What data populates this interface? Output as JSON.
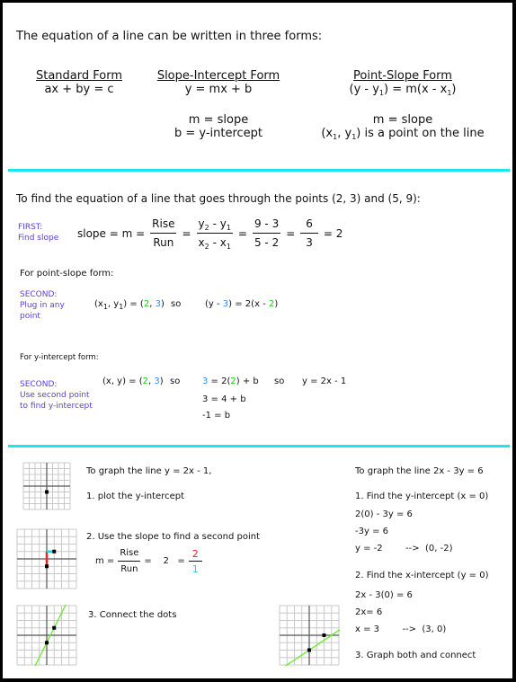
{
  "intro": "The equation of a line can be written in three forms:",
  "forms": [
    {
      "title": "Standard Form",
      "equation": "ax + by = c"
    },
    {
      "title": "Slope-Intercept Form",
      "equation": "y = mx + b",
      "notes": [
        "m = slope",
        "b = y-intercept"
      ]
    },
    {
      "title": "Point-Slope Form",
      "equation_parts": [
        "(y - y",
        "1",
        ") = m(x - x",
        "1",
        ")"
      ],
      "notes": [
        "m = slope"
      ],
      "note2_parts": [
        "(x",
        "1",
        ", y",
        "1",
        ") is a point on the line"
      ]
    }
  ],
  "example": {
    "prompt": "To find the equation of a line that goes through the points (2, 3) and (5, 9):",
    "first": {
      "label_line1": "FIRST:",
      "label_line2": "Find slope",
      "lhs": "slope = m =",
      "rise": "Rise",
      "run": "Run",
      "eq": "=",
      "y2": "y",
      "y2sub": "2",
      "ydash": " - y",
      "y1sub": "1",
      "x2": "x",
      "x2sub": "2",
      "xdash": " - x",
      "x1sub": "1",
      "num1": "9 - 3",
      "den1": "5 - 2",
      "num2": "6",
      "den2": "3",
      "result": "= 2"
    },
    "point_slope_heading": "For point-slope form:",
    "second_ps": {
      "label_line1": "SECOND:",
      "label_line2": "Plug in any",
      "label_line3": "point",
      "lhs_a": "(x",
      "lhs_sub1": "1",
      "lhs_b": ", y",
      "lhs_sub2": "1",
      "lhs_c": ") = (",
      "px": "2",
      "comma": ", ",
      "py": "3",
      "close": ")",
      "so": "so",
      "res_a": "(y - ",
      "res_y": "3",
      "res_b": ") = 2(x - ",
      "res_x": "2",
      "res_c": ")"
    },
    "y_intercept_heading": "For y-intercept form:",
    "second_yi": {
      "label_line1": "SECOND:",
      "label_line2": "Use second point",
      "label_line3": "to find y-intercept",
      "lhs": "(x, y) = (",
      "px": "2",
      "comma": ", ",
      "py": "3",
      "close": ")",
      "so1": "so",
      "step1_y": "3",
      "step1_a": " = 2(",
      "step1_x": "2",
      "step1_b": ") + b",
      "so2": "so",
      "result": "y = 2x - 1",
      "step2": "3 = 4 + b",
      "step3": "-1 = b"
    }
  },
  "graphing_left": {
    "heading": "To graph the line y = 2x - 1,",
    "step1": "1.  plot the y-intercept",
    "step2": "2. Use the slope to find a second point",
    "slope_m": "m =",
    "rise": "Rise",
    "run": "Run",
    "eq_two": "=    2   =",
    "two": "2",
    "one": "1",
    "step3": "3.  Connect the dots"
  },
  "graphing_right": {
    "heading": "To graph the line 2x - 3y = 6",
    "step1": "1.  Find the y-intercept (x = 0)",
    "s1a": "2(0) - 3y = 6",
    "s1b": "-3y = 6",
    "s1c": "y = -2        -->  (0, -2)",
    "step2": "2.  Find the x-intercept (y = 0)",
    "s2a": "2x - 3(0) = 6",
    "s2b": "2x= 6",
    "s2c": "x = 3        -->  (3, 0)",
    "step3": "3.  Graph both and connect"
  },
  "colors": {
    "divider": "#19e6ee",
    "label": "#5a3ee0",
    "x_value": "#22cc22",
    "y_value": "#3a8ef0",
    "rise": "#ee2222",
    "run": "#18d6ee",
    "line": "#66ee22"
  }
}
